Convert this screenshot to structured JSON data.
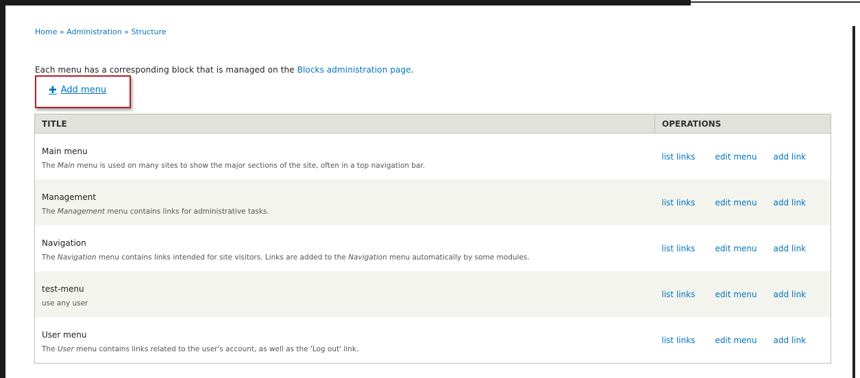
{
  "breadcrumb": {
    "items": [
      "Home",
      "Administration",
      "Structure"
    ],
    "separator": "»"
  },
  "intro": {
    "text": "Each menu has a corresponding block that is managed on the",
    "link": "Blocks administration page",
    "end": "."
  },
  "actions": {
    "add_menu_label": "Add menu",
    "add_menu_icon": "plus-icon"
  },
  "table": {
    "headers": {
      "title": "TITLE",
      "operations": "OPERATIONS"
    },
    "rows": [
      {
        "title": "Main menu",
        "desc_before": "The ",
        "desc_em": "Main",
        "desc_after": " menu is used on many sites to show the major sections of the site, often in a top navigation bar.",
        "ops": [
          "list links",
          "edit menu",
          "add link"
        ]
      },
      {
        "title": "Management",
        "desc_before": "The ",
        "desc_em": "Management",
        "desc_after": " menu contains links for administrative tasks.",
        "ops": [
          "list links",
          "edit menu",
          "add link"
        ]
      },
      {
        "title": "Navigation",
        "desc_before": "The ",
        "desc_em": "Navigation",
        "desc_after": " menu contains links intended for site visitors. Links are added to the ",
        "desc_em2": "Navigation",
        "desc_after2": " menu automatically by some modules.",
        "ops": [
          "list links",
          "edit menu",
          "add link"
        ]
      },
      {
        "title": "test-menu",
        "desc_before": "use any user",
        "desc_em": "",
        "desc_after": "",
        "ops": [
          "list links",
          "edit menu",
          "add link"
        ]
      },
      {
        "title": "User menu",
        "desc_before": "The ",
        "desc_em": "User",
        "desc_after": " menu contains links related to the user's account, as well as the 'Log out' link.",
        "ops": [
          "list links",
          "edit menu",
          "add link"
        ]
      }
    ]
  },
  "colors": {
    "link": "#0074bd",
    "highlight_border": "#b51f23",
    "header_bg": "#e1e2dc",
    "even_row_bg": "#f3f4ee"
  }
}
